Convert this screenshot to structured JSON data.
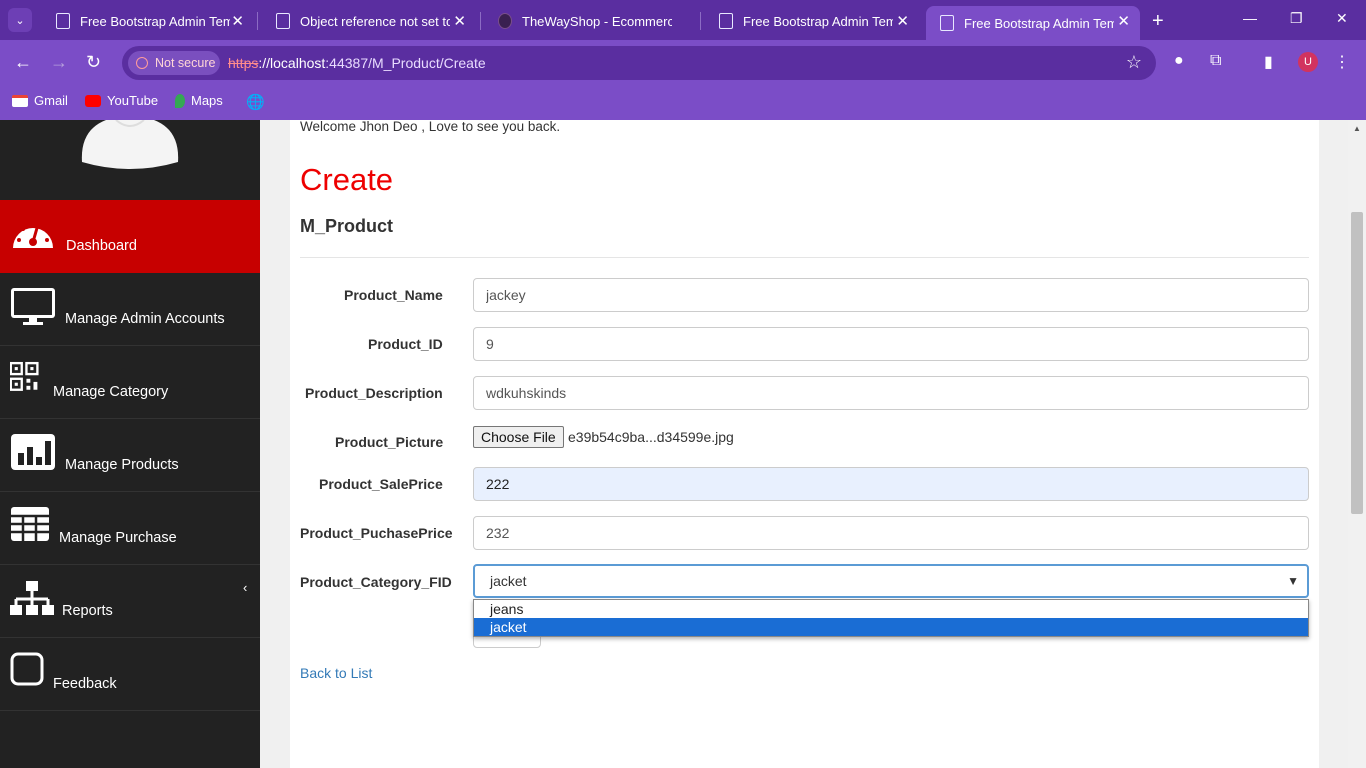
{
  "browser": {
    "tabs": [
      {
        "title": "Free Bootstrap Admin Templ",
        "active": false
      },
      {
        "title": "Object reference not set to a",
        "active": false
      },
      {
        "title": "TheWayShop - Ecommerce B",
        "active": false
      },
      {
        "title": "Free Bootstrap Admin Templ",
        "active": false
      },
      {
        "title": "Free Bootstrap Admin Templ",
        "active": true
      }
    ],
    "security_label": "Not secure",
    "url_scheme": "https",
    "url_host": "://localhost",
    "url_rest": ":44387/M_Product/Create",
    "profile_initial": "U",
    "bookmarks": [
      "Gmail",
      "YouTube",
      "Maps"
    ],
    "colors": {
      "frame": "#5a2ea0",
      "toolbar": "#7b4dc7"
    }
  },
  "sidebar": {
    "items": [
      {
        "label": "Dashboard",
        "icon": "dashboard-gauge-icon",
        "active": true
      },
      {
        "label": "Manage Admin Accounts",
        "icon": "monitor-icon",
        "active": false
      },
      {
        "label": "Manage Category",
        "icon": "qr-code-icon",
        "active": false
      },
      {
        "label": "Manage Products",
        "icon": "bar-chart-icon",
        "active": false
      },
      {
        "label": "Manage Purchase",
        "icon": "table-grid-icon",
        "active": false
      },
      {
        "label": "Reports",
        "icon": "sitemap-icon",
        "active": false
      },
      {
        "label": "Feedback",
        "icon": "square-icon",
        "active": false
      }
    ],
    "collapse_glyph": "‹",
    "colors": {
      "background": "#222222",
      "active": "#c70000"
    }
  },
  "main": {
    "welcome": "Welcome Jhon Deo , Love to see you back.",
    "title": "Create",
    "subtitle": "M_Product",
    "fields": {
      "product_name": {
        "label": "Product_Name",
        "value": "jackey"
      },
      "product_id": {
        "label": "Product_ID",
        "value": "9"
      },
      "product_description": {
        "label": "Product_Description",
        "value": "wdkuhskinds"
      },
      "product_picture": {
        "label": "Product_Picture",
        "button": "Choose File",
        "file": "e39b54c9ba...d34599e.jpg"
      },
      "product_saleprice": {
        "label": "Product_SalePrice",
        "value": "222"
      },
      "product_purchaseprice": {
        "label": "Product_PuchasePrice",
        "value": "232"
      },
      "product_category": {
        "label": "Product_Category_FID",
        "value": "jacket",
        "options": [
          "jeans",
          "jacket"
        ]
      }
    },
    "back_link": "Back to List",
    "colors": {
      "title": "#ee0000",
      "link": "#337ab7"
    }
  }
}
